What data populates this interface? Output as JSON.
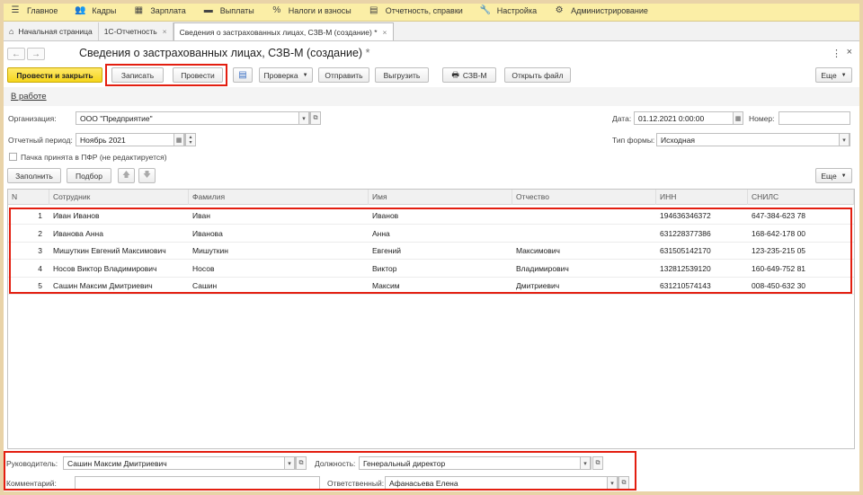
{
  "menu": [
    {
      "icon": "hamburger-icon",
      "glyph": "☰",
      "label": "Главное"
    },
    {
      "icon": "people-icon",
      "glyph": "👥",
      "label": "Кадры"
    },
    {
      "icon": "calculator-icon",
      "glyph": "▦",
      "label": "Зарплата"
    },
    {
      "icon": "wallet-icon",
      "glyph": "▬",
      "label": "Выплаты"
    },
    {
      "icon": "percent-icon",
      "glyph": "%",
      "label": "Налоги и взносы"
    },
    {
      "icon": "report-icon",
      "glyph": "▤",
      "label": "Отчетность, справки"
    },
    {
      "icon": "wrench-icon",
      "glyph": "🔧",
      "label": "Настройка"
    },
    {
      "icon": "gear-icon",
      "glyph": "⚙",
      "label": "Администрирование"
    }
  ],
  "tabs": [
    {
      "label": "Начальная страница",
      "closable": false
    },
    {
      "label": "1С-Отчетность",
      "closable": true
    },
    {
      "label": "Сведения о застрахованных лицах, СЗВ-М (создание) *",
      "closable": true
    }
  ],
  "form": {
    "title": "Сведения о застрахованных лицах, СЗВ-М (создание)",
    "title_mark": "*",
    "status": "В работе"
  },
  "toolbar": {
    "post_close": "Провести и закрыть",
    "save": "Записать",
    "post": "Провести",
    "check": "Проверка",
    "send": "Отправить",
    "upload": "Выгрузить",
    "print": "СЗВ-М",
    "open_file": "Открыть файл",
    "more": "Еще"
  },
  "fields": {
    "org_label": "Организация:",
    "org_value": "ООО \"Предприятие\"",
    "date_label": "Дата:",
    "date_value": "01.12.2021  0:00:00",
    "number_label": "Номер:",
    "number_value": "",
    "period_label": "Отчетный период:",
    "period_value": "Ноябрь 2021",
    "form_type_label": "Тип формы:",
    "form_type_value": "Исходная",
    "accepted_label": "Пачка принята в ПФР (не редактируется)",
    "accepted_checked": false
  },
  "table_toolbar": {
    "fill": "Заполнить",
    "select": "Подбор",
    "more": "Еще"
  },
  "table": {
    "columns": [
      "N",
      "Сотрудник",
      "Фамилия",
      "Имя",
      "Отчество",
      "ИНН",
      "СНИЛС"
    ],
    "rows": [
      [
        "1",
        "Иван Иванов",
        "Иван",
        "Иванов",
        "",
        "194636346372",
        "647-384-623 78"
      ],
      [
        "2",
        "Иванова Анна",
        "Иванова",
        "Анна",
        "",
        "631228377386",
        "168-642-178 00"
      ],
      [
        "3",
        "Мишуткин Евгений Максимович",
        "Мишуткин",
        "Евгений",
        "Максимович",
        "631505142170",
        "123-235-215 05"
      ],
      [
        "4",
        "Носов Виктор Владимирович",
        "Носов",
        "Виктор",
        "Владимирович",
        "132812539120",
        "160-649-752 81"
      ],
      [
        "5",
        "Сашин Максим Дмитриевич",
        "Сашин",
        "Максим",
        "Дмитриевич",
        "631210574143",
        "008-450-632 30"
      ]
    ]
  },
  "footer": {
    "head_label": "Руководитель:",
    "head_value": "Сашин Максим Дмитриевич",
    "position_label": "Должность:",
    "position_value": "Генеральный директор",
    "comment_label": "Комментарий:",
    "comment_value": "",
    "responsible_label": "Ответственный:",
    "responsible_value": "Афанасьева Елена"
  },
  "colors": {
    "menu_bar": "#fbeea6",
    "primary_button": "#f5d51c",
    "highlight": "#e31e10",
    "frame": "#e9d3a8"
  }
}
